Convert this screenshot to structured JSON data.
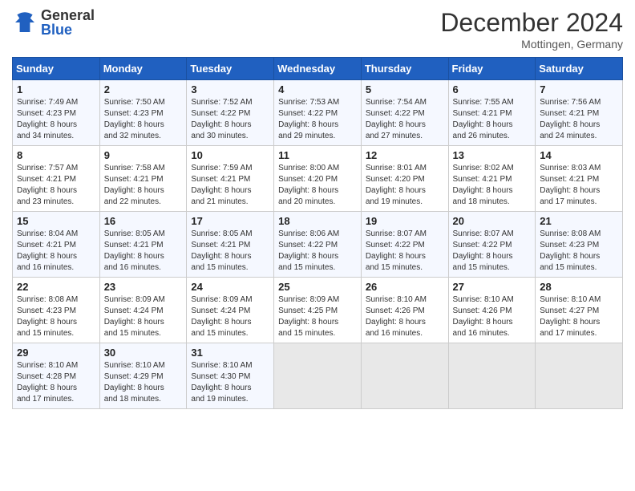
{
  "header": {
    "logo_general": "General",
    "logo_blue": "Blue",
    "title": "December 2024",
    "location": "Mottingen, Germany"
  },
  "columns": [
    "Sunday",
    "Monday",
    "Tuesday",
    "Wednesday",
    "Thursday",
    "Friday",
    "Saturday"
  ],
  "weeks": [
    [
      {
        "day": "1",
        "info": "Sunrise: 7:49 AM\nSunset: 4:23 PM\nDaylight: 8 hours\nand 34 minutes."
      },
      {
        "day": "2",
        "info": "Sunrise: 7:50 AM\nSunset: 4:23 PM\nDaylight: 8 hours\nand 32 minutes."
      },
      {
        "day": "3",
        "info": "Sunrise: 7:52 AM\nSunset: 4:22 PM\nDaylight: 8 hours\nand 30 minutes."
      },
      {
        "day": "4",
        "info": "Sunrise: 7:53 AM\nSunset: 4:22 PM\nDaylight: 8 hours\nand 29 minutes."
      },
      {
        "day": "5",
        "info": "Sunrise: 7:54 AM\nSunset: 4:22 PM\nDaylight: 8 hours\nand 27 minutes."
      },
      {
        "day": "6",
        "info": "Sunrise: 7:55 AM\nSunset: 4:21 PM\nDaylight: 8 hours\nand 26 minutes."
      },
      {
        "day": "7",
        "info": "Sunrise: 7:56 AM\nSunset: 4:21 PM\nDaylight: 8 hours\nand 24 minutes."
      }
    ],
    [
      {
        "day": "8",
        "info": "Sunrise: 7:57 AM\nSunset: 4:21 PM\nDaylight: 8 hours\nand 23 minutes."
      },
      {
        "day": "9",
        "info": "Sunrise: 7:58 AM\nSunset: 4:21 PM\nDaylight: 8 hours\nand 22 minutes."
      },
      {
        "day": "10",
        "info": "Sunrise: 7:59 AM\nSunset: 4:21 PM\nDaylight: 8 hours\nand 21 minutes."
      },
      {
        "day": "11",
        "info": "Sunrise: 8:00 AM\nSunset: 4:20 PM\nDaylight: 8 hours\nand 20 minutes."
      },
      {
        "day": "12",
        "info": "Sunrise: 8:01 AM\nSunset: 4:20 PM\nDaylight: 8 hours\nand 19 minutes."
      },
      {
        "day": "13",
        "info": "Sunrise: 8:02 AM\nSunset: 4:21 PM\nDaylight: 8 hours\nand 18 minutes."
      },
      {
        "day": "14",
        "info": "Sunrise: 8:03 AM\nSunset: 4:21 PM\nDaylight: 8 hours\nand 17 minutes."
      }
    ],
    [
      {
        "day": "15",
        "info": "Sunrise: 8:04 AM\nSunset: 4:21 PM\nDaylight: 8 hours\nand 16 minutes."
      },
      {
        "day": "16",
        "info": "Sunrise: 8:05 AM\nSunset: 4:21 PM\nDaylight: 8 hours\nand 16 minutes."
      },
      {
        "day": "17",
        "info": "Sunrise: 8:05 AM\nSunset: 4:21 PM\nDaylight: 8 hours\nand 15 minutes."
      },
      {
        "day": "18",
        "info": "Sunrise: 8:06 AM\nSunset: 4:22 PM\nDaylight: 8 hours\nand 15 minutes."
      },
      {
        "day": "19",
        "info": "Sunrise: 8:07 AM\nSunset: 4:22 PM\nDaylight: 8 hours\nand 15 minutes."
      },
      {
        "day": "20",
        "info": "Sunrise: 8:07 AM\nSunset: 4:22 PM\nDaylight: 8 hours\nand 15 minutes."
      },
      {
        "day": "21",
        "info": "Sunrise: 8:08 AM\nSunset: 4:23 PM\nDaylight: 8 hours\nand 15 minutes."
      }
    ],
    [
      {
        "day": "22",
        "info": "Sunrise: 8:08 AM\nSunset: 4:23 PM\nDaylight: 8 hours\nand 15 minutes."
      },
      {
        "day": "23",
        "info": "Sunrise: 8:09 AM\nSunset: 4:24 PM\nDaylight: 8 hours\nand 15 minutes."
      },
      {
        "day": "24",
        "info": "Sunrise: 8:09 AM\nSunset: 4:24 PM\nDaylight: 8 hours\nand 15 minutes."
      },
      {
        "day": "25",
        "info": "Sunrise: 8:09 AM\nSunset: 4:25 PM\nDaylight: 8 hours\nand 15 minutes."
      },
      {
        "day": "26",
        "info": "Sunrise: 8:10 AM\nSunset: 4:26 PM\nDaylight: 8 hours\nand 16 minutes."
      },
      {
        "day": "27",
        "info": "Sunrise: 8:10 AM\nSunset: 4:26 PM\nDaylight: 8 hours\nand 16 minutes."
      },
      {
        "day": "28",
        "info": "Sunrise: 8:10 AM\nSunset: 4:27 PM\nDaylight: 8 hours\nand 17 minutes."
      }
    ],
    [
      {
        "day": "29",
        "info": "Sunrise: 8:10 AM\nSunset: 4:28 PM\nDaylight: 8 hours\nand 17 minutes."
      },
      {
        "day": "30",
        "info": "Sunrise: 8:10 AM\nSunset: 4:29 PM\nDaylight: 8 hours\nand 18 minutes."
      },
      {
        "day": "31",
        "info": "Sunrise: 8:10 AM\nSunset: 4:30 PM\nDaylight: 8 hours\nand 19 minutes."
      },
      null,
      null,
      null,
      null
    ]
  ]
}
